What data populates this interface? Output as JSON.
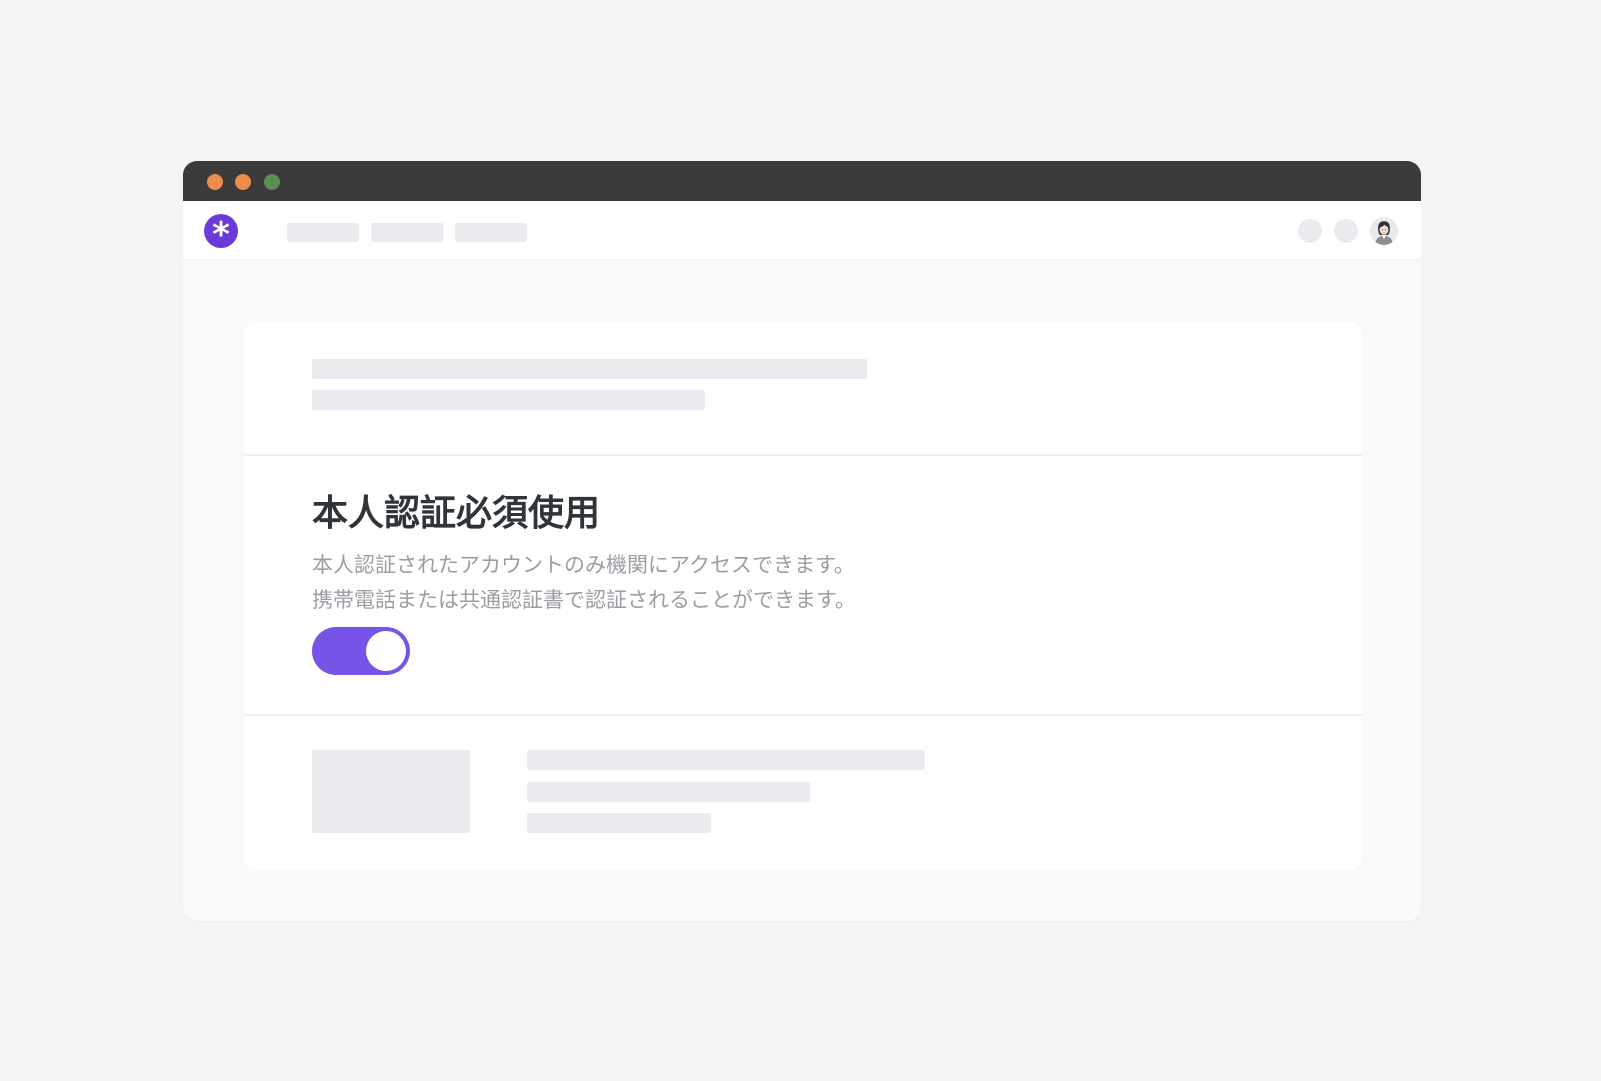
{
  "window": {
    "traffic_lights": [
      "#ed8d4c",
      "#ed8d4c",
      "#5a8d52"
    ],
    "titlebar_color": "#3b3b3b"
  },
  "topbar": {
    "logo": {
      "icon": "asterisk-icon",
      "glyph": "*",
      "color": "#6a3bd9"
    },
    "nav_placeholders": 3,
    "right_placeholders": 2,
    "avatar": {
      "icon": "user-avatar-icon"
    }
  },
  "setting": {
    "title": "本人認証必須使用",
    "description_line1": "本人認証されたアカウントのみ機関にアクセスできます。",
    "description_line2": "携帯電話または共通認証書で認証されることができます。",
    "toggle_on": true,
    "accent_color": "#7654e8"
  }
}
